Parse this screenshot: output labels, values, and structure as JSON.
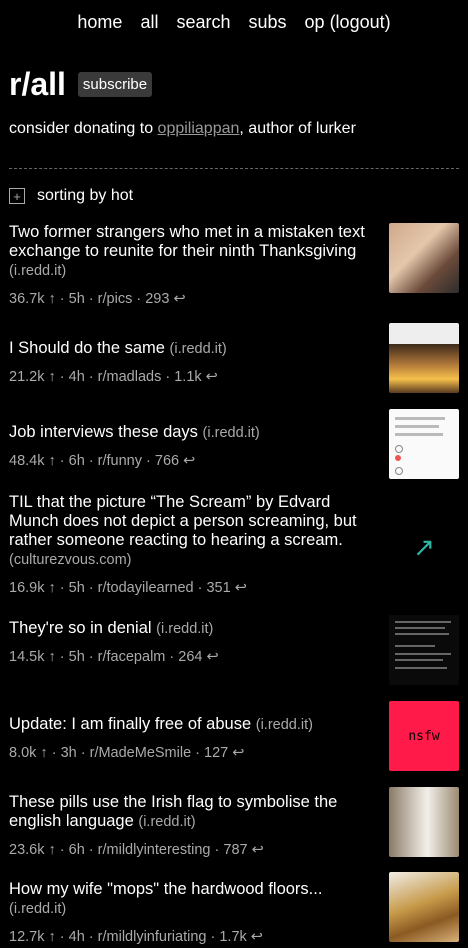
{
  "nav": {
    "home": "home",
    "all": "all",
    "search": "search",
    "subs": "subs",
    "user": "op",
    "logout": "(logout)"
  },
  "subreddit": {
    "title": "r/all",
    "subscribe_label": "subscribe"
  },
  "donate": {
    "prefix": "consider donating to ",
    "link": "oppiliappan",
    "suffix": ", author of lurker"
  },
  "sorting": {
    "toggle_icon": "plus-box-icon",
    "label": "sorting by hot"
  },
  "posts": [
    {
      "title": "Two former strangers who met in a mistaken text exchange to reunite for their ninth Thanksgiving",
      "domain": "(i.redd.it)",
      "score": "36.7k ↑",
      "age": "5h",
      "subreddit": "r/pics",
      "comments": "293 ↩"
    },
    {
      "title": "I Should do the same",
      "domain": "(i.redd.it)",
      "score": "21.2k ↑",
      "age": "4h",
      "subreddit": "r/madlads",
      "comments": "1.1k ↩"
    },
    {
      "title": "Job interviews these days",
      "domain": "(i.redd.it)",
      "score": "48.4k ↑",
      "age": "6h",
      "subreddit": "r/funny",
      "comments": "766 ↩"
    },
    {
      "title": "TIL that the picture “The Scream” by Edvard Munch does not depict a person screaming, but rather someone reacting to hearing a scream.",
      "domain": "(culturezvous.com)",
      "score": "16.9k ↑",
      "age": "5h",
      "subreddit": "r/todayilearned",
      "comments": "351 ↩"
    },
    {
      "title": "They're so in denial",
      "domain": "(i.redd.it)",
      "score": "14.5k ↑",
      "age": "5h",
      "subreddit": "r/facepalm",
      "comments": "264 ↩"
    },
    {
      "title": "Update: I am finally free of abuse",
      "domain": "(i.redd.it)",
      "score": "8.0k ↑",
      "age": "3h",
      "subreddit": "r/MadeMeSmile",
      "comments": "127 ↩",
      "thumb_label": "nsfw"
    },
    {
      "title": "These pills use the Irish flag to symbolise the english language",
      "domain": "(i.redd.it)",
      "score": "23.6k ↑",
      "age": "6h",
      "subreddit": "r/mildlyinteresting",
      "comments": "787 ↩"
    },
    {
      "title": "How my wife \"mops\" the hardwood floors...",
      "domain": "(i.redd.it)",
      "score": "12.7k ↑",
      "age": "4h",
      "subreddit": "r/mildlyinfuriating",
      "comments": "1.7k ↩"
    }
  ],
  "colors": {
    "background": "#000000",
    "text": "#ffffff",
    "muted": "#aaaaaa",
    "nsfw": "#ff1a4a",
    "external_link": "#2fb7a5"
  }
}
